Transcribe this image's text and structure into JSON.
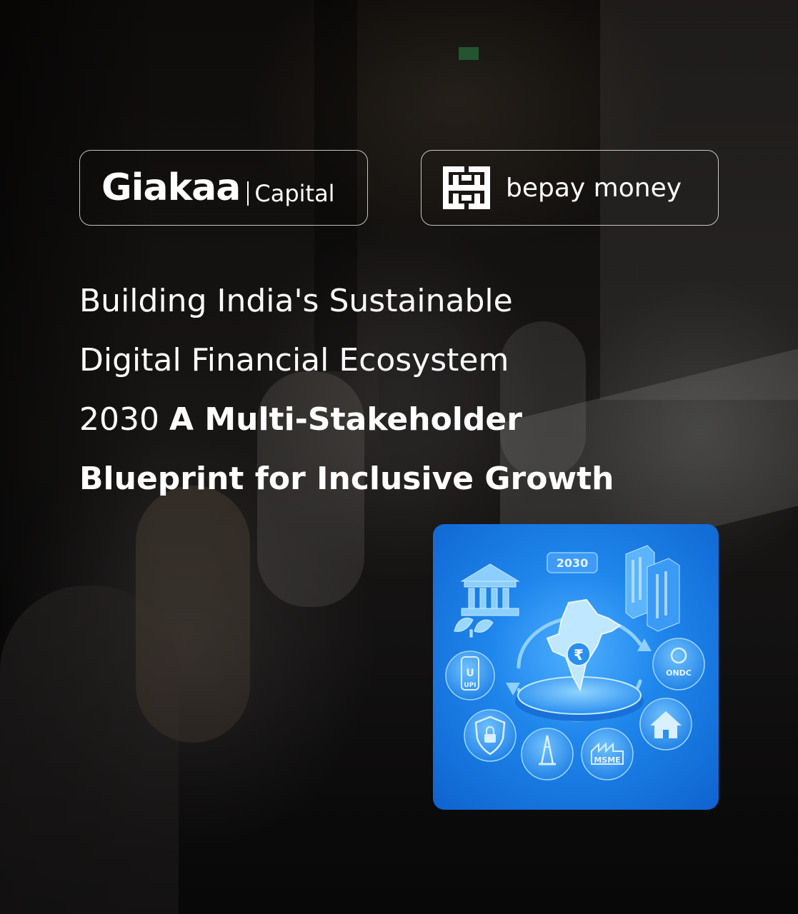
{
  "logos": {
    "giakaa": {
      "name": "Giakaa",
      "sub": "Capital"
    },
    "bepay": {
      "name": "bepay money",
      "icon": "bepay-grid-icon"
    }
  },
  "headline": {
    "line1": "Building India's Sustainable",
    "line2": "Digital Financial Ecosystem",
    "line3_regular": "2030 ",
    "line3_bold": "A Multi-Stakeholder",
    "line4_bold": "Blueprint for Inclusive Growth"
  },
  "illustration": {
    "year_badge": "2030",
    "center_symbol": "₹",
    "badges": {
      "upi_letter": "U",
      "upi": "UPI",
      "ondc": "ONDC",
      "msme": "MSME"
    },
    "icons": [
      "bank-icon",
      "buildings-icon",
      "leaf-icon",
      "upi-icon",
      "ondc-icon",
      "home-icon",
      "shield-lock-icon",
      "oil-rig-icon",
      "msme-factory-icon",
      "india-map-icon"
    ],
    "colors": {
      "panel": "#1f86ec",
      "light": "#7cc8ff",
      "dark": "#0b56b8"
    }
  }
}
